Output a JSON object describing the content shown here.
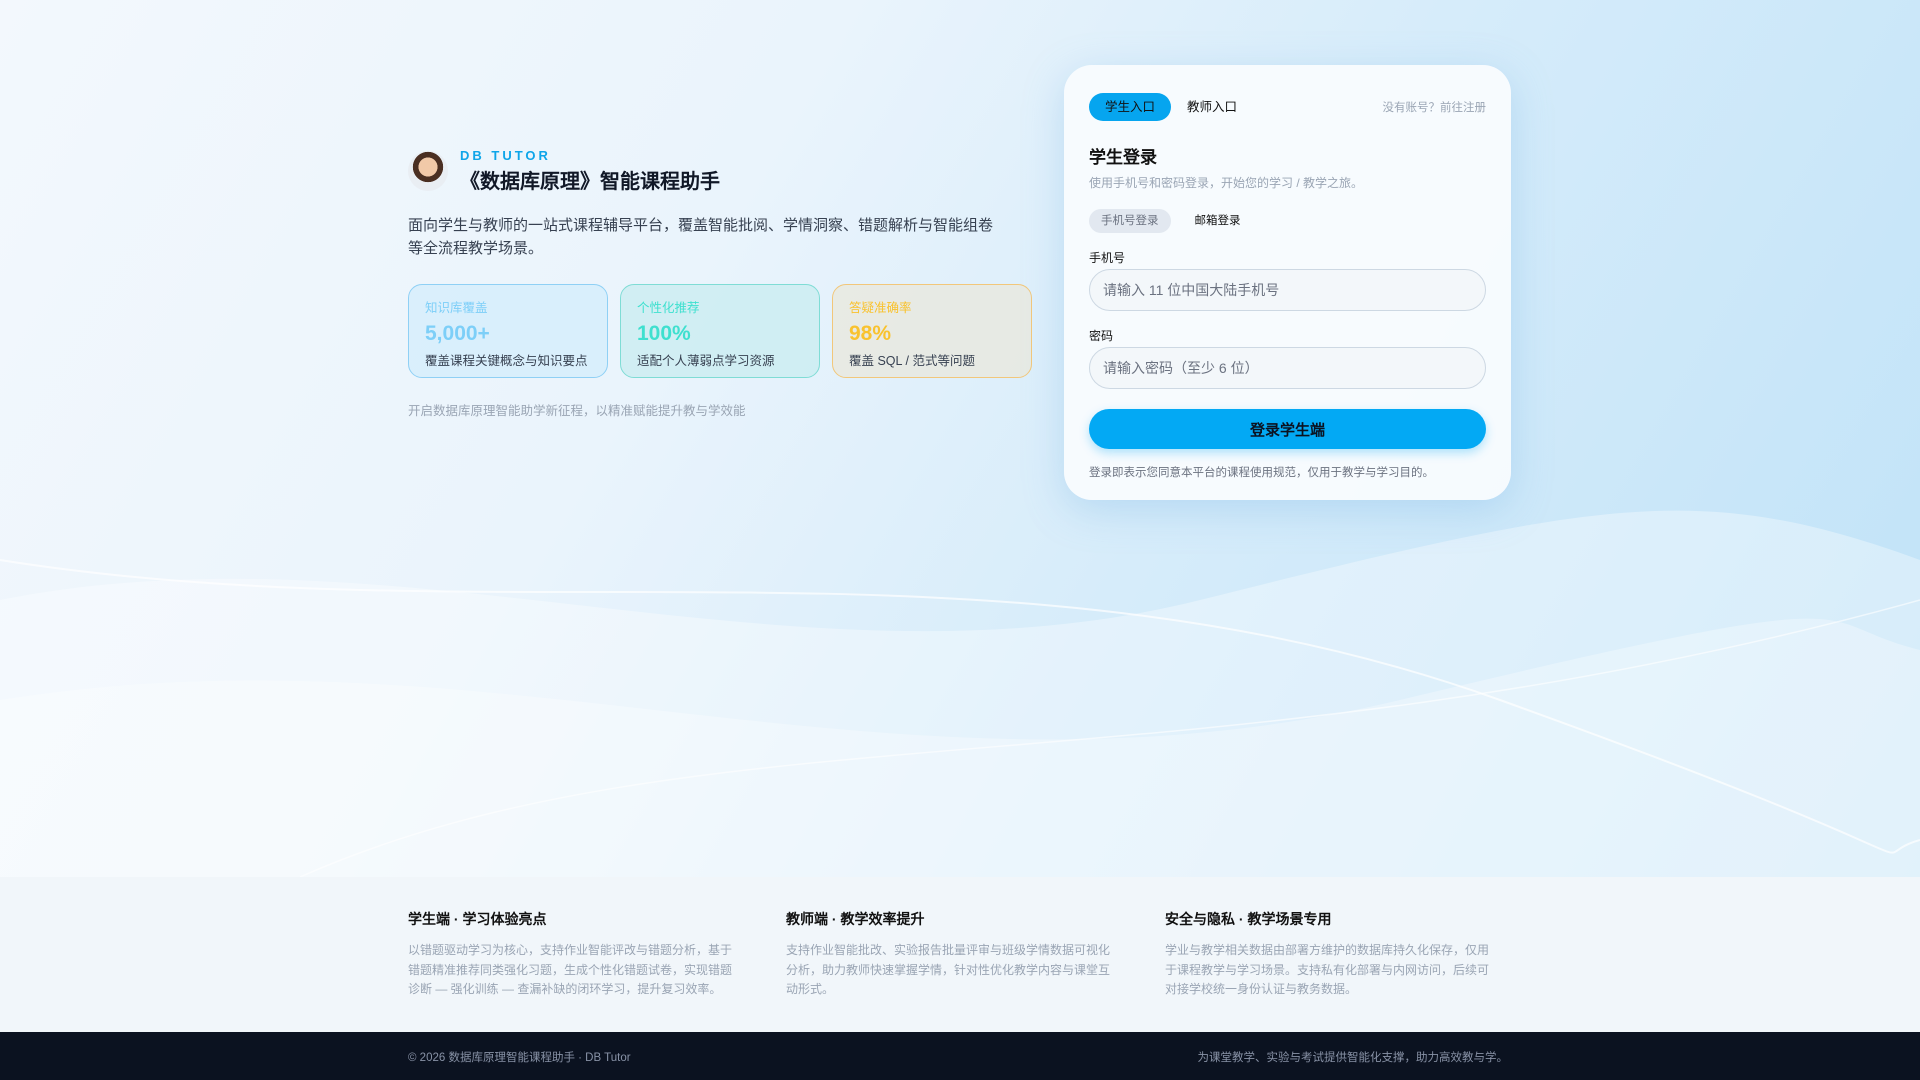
{
  "brand": {
    "subtitle": "DB TUTOR",
    "title": "《数据库原理》智能课程助手"
  },
  "hero": {
    "description": "面向学生与教师的一站式课程辅导平台，覆盖智能批阅、学情洞察、错题解析与智能组卷等全流程教学场景。",
    "stats": [
      {
        "label": "知识库覆盖",
        "value": "5,000+",
        "desc": "覆盖课程关键概念与知识要点"
      },
      {
        "label": "个性化推荐",
        "value": "100%",
        "desc": "适配个人薄弱点学习资源"
      },
      {
        "label": "答疑准确率",
        "value": "98%",
        "desc": "覆盖 SQL / 范式等问题"
      }
    ],
    "tagline": "开启数据库原理智能助学新征程，以精准赋能提升教与学效能"
  },
  "login": {
    "tabs": [
      "学生入口",
      "教师入口"
    ],
    "register": "没有账号？前往注册",
    "title": "学生登录",
    "subtitle": "使用手机号和密码登录，开始您的学习 / 教学之旅。",
    "methods": [
      "手机号登录",
      "邮箱登录"
    ],
    "phone_label": "手机号",
    "phone_placeholder": "请输入 11 位中国大陆手机号",
    "password_label": "密码",
    "password_placeholder": "请输入密码（至少 6 位）",
    "submit": "登录学生端",
    "terms": "登录即表示您同意本平台的课程使用规范，仅用于教学与学习目的。"
  },
  "features": [
    {
      "title": "学生端 · 学习体验亮点",
      "text": "以错题驱动学习为核心，支持作业智能评改与错题分析，基于错题精准推荐同类强化习题，生成个性化错题试卷，实现错题诊断 — 强化训练 — 查漏补缺的闭环学习，提升复习效率。"
    },
    {
      "title": "教师端 · 教学效率提升",
      "text": "支持作业智能批改、实验报告批量评审与班级学情数据可视化分析，助力教师快速掌握学情，针对性优化教学内容与课堂互动形式。"
    },
    {
      "title": "安全与隐私 · 教学场景专用",
      "text": "学业与教学相关数据由部署方维护的数据库持久化保存，仅用于课程教学与学习场景。支持私有化部署与内网访问，后续可对接学校统一身份认证与教务数据。"
    }
  ],
  "footer": {
    "left": "© 2026 数据库原理智能课程助手 · DB Tutor",
    "right": "为课堂教学、实验与考试提供智能化支撑，助力高效教与学。"
  }
}
